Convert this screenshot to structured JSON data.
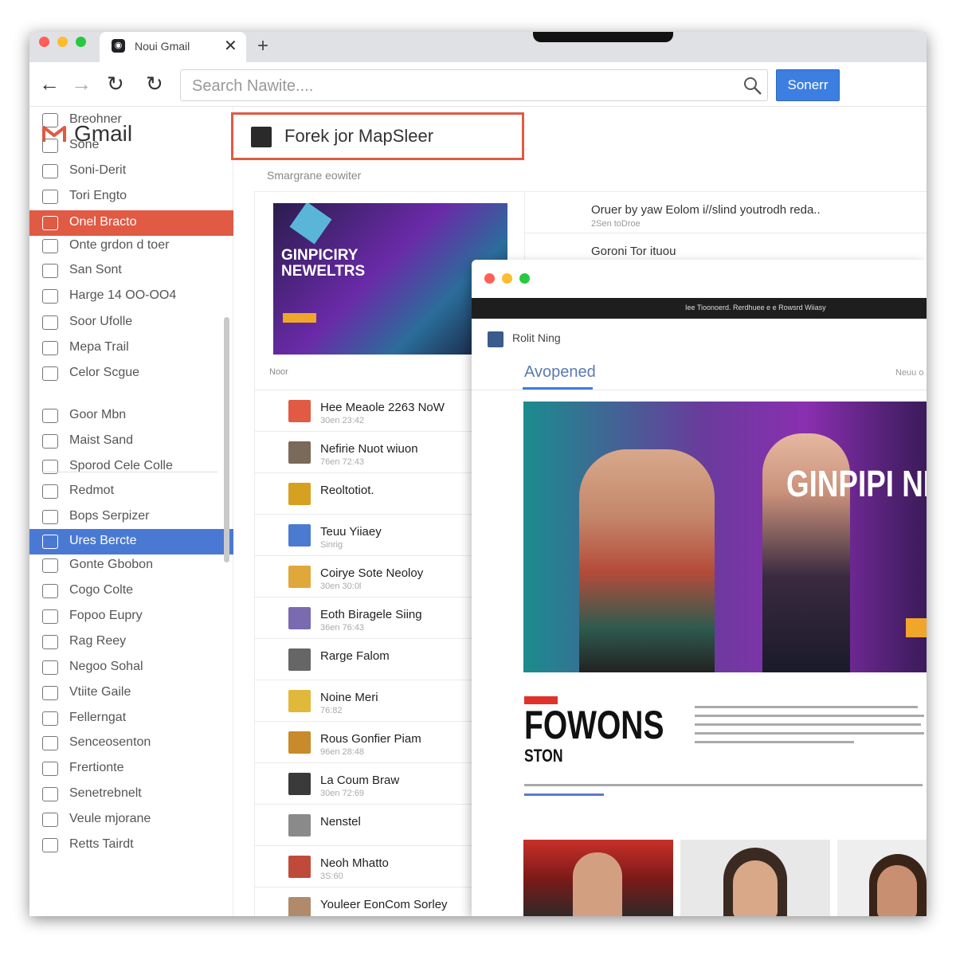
{
  "browser": {
    "tab_title": "Noui Gmail",
    "tab_close_glyph": "✕",
    "new_tab_glyph": "+",
    "back_glyph": "←",
    "forward_glyph": "→",
    "reload_glyph": "↻",
    "reload2_glyph": "↻",
    "search_placeholder": "Search Nawite....",
    "search_button_label": "Sonerr"
  },
  "sidebar": {
    "logo_text": "Gmail",
    "items": [
      {
        "label": "Breohner",
        "icon": "inbox-icon"
      },
      {
        "label": "Sone",
        "icon": "list-icon"
      },
      {
        "label": "Soni-Derit",
        "icon": "send-icon"
      },
      {
        "label": "Tori Engto",
        "icon": "folder-icon"
      },
      {
        "label": "Onel Bracto",
        "icon": "close-icon",
        "state": "active-red"
      },
      {
        "label": "Onte grdon d toer",
        "icon": "note-icon"
      },
      {
        "label": "San Sont",
        "icon": "pin-icon"
      },
      {
        "label": "Harge 14 OO-OO4",
        "icon": "search-icon"
      },
      {
        "label": "Soor Ufolle",
        "icon": "clock-icon"
      },
      {
        "label": "Mepa Trail",
        "icon": "mail-icon"
      },
      {
        "label": "Celor Scgue",
        "icon": "list-icon"
      },
      {
        "label": "Goor Mbn",
        "icon": "calendar-icon"
      },
      {
        "label": "Maist Sand",
        "icon": "tag-icon"
      },
      {
        "label": "Sporod Cele Colle",
        "icon": "doc-icon"
      },
      {
        "label": "Redmot",
        "icon": "diamond-icon"
      },
      {
        "label": "Bops Serpizer",
        "icon": "dollar-icon"
      },
      {
        "label": "Ures Bercte",
        "icon": "book-icon",
        "state": "active-blue"
      },
      {
        "label": "Gonte Gbobon",
        "icon": "grid-icon"
      },
      {
        "label": "Cogo Colte",
        "icon": "image-icon"
      },
      {
        "label": "Fopoo Eupry",
        "icon": "chat-icon"
      },
      {
        "label": "Rag Reey",
        "icon": "face-icon"
      },
      {
        "label": "Negoo Sohal",
        "icon": "warning-icon"
      },
      {
        "label": "Vtiite Gaile",
        "icon": "doc-icon"
      },
      {
        "label": "Fellerngat",
        "icon": "archive-icon"
      },
      {
        "label": "Senceosenton",
        "icon": "calculator-icon"
      },
      {
        "label": "Frertionte",
        "icon": "folder-icon"
      },
      {
        "label": "Senetrebnelt",
        "icon": "list-icon"
      },
      {
        "label": "Veule mjorane",
        "icon": "chat-icon"
      },
      {
        "label": "Retts Tairdt",
        "icon": "circle-icon"
      }
    ]
  },
  "main": {
    "heading": "Forek jor MapSleer",
    "subheading": "Smargrane eowiter",
    "poster_title": "GINPICIRY NEWELTRS",
    "panel_label": "Noor",
    "news_top": [
      {
        "title": "Oruer by yaw Eolom i//slind youtrodh reda..",
        "meta": "2Sen toDroe"
      },
      {
        "title": "Goroni Tor ituou",
        "meta": ""
      }
    ],
    "messages": [
      {
        "title": "Hee Meaole 2263 NoW",
        "meta": "30en 23:42",
        "color": "#e05a44"
      },
      {
        "title": "Nefirie Nuot wiuon",
        "meta": "76en 72:43",
        "color": "#7a6a5a"
      },
      {
        "title": "Reoltotiot.",
        "meta": "",
        "color": "#d6a020"
      },
      {
        "title": "Teuu Yiiaey",
        "meta": "Sinrig",
        "color": "#4a7bd0"
      },
      {
        "title": "Coirye Sote Neoloy",
        "meta": "30en 30:0l",
        "color": "#e0a83a"
      },
      {
        "title": "Eoth Biragele Siing",
        "meta": "36en 76:43",
        "color": "#7a6ab0"
      },
      {
        "title": "Rarge Falom",
        "meta": "",
        "color": "#666666"
      },
      {
        "title": "Noine Meri",
        "meta": "76:82",
        "color": "#e0b83a"
      },
      {
        "title": "Rous Gonfier Piam",
        "meta": "96en 28:48",
        "color": "#c88a2a"
      },
      {
        "title": "La Coum Braw",
        "meta": "30en 72:69",
        "color": "#3a3a3a"
      },
      {
        "title": "Nenstel",
        "meta": "",
        "color": "#8a8a8a"
      },
      {
        "title": "Neoh Mhatto",
        "meta": "3S:60",
        "color": "#c04a3a"
      },
      {
        "title": "Youleer EonCom Sorley",
        "meta": "",
        "color": "#b08a6a"
      }
    ]
  },
  "overlay": {
    "topbar_text": "Iee Tioonoerd. Rerdhuee e e Rowsrd Wiiasy",
    "site_name": "Rolit Ning",
    "tab_label": "Avopened",
    "right_link": "Neuu o",
    "hero_title": "GINPIPI NEWELLT",
    "brand_line1": "FOWONS",
    "brand_line2": "STON"
  },
  "colors": {
    "accent_red": "#e05a44",
    "accent_blue": "#3c7fe0",
    "active_blue": "#4a79d4"
  }
}
